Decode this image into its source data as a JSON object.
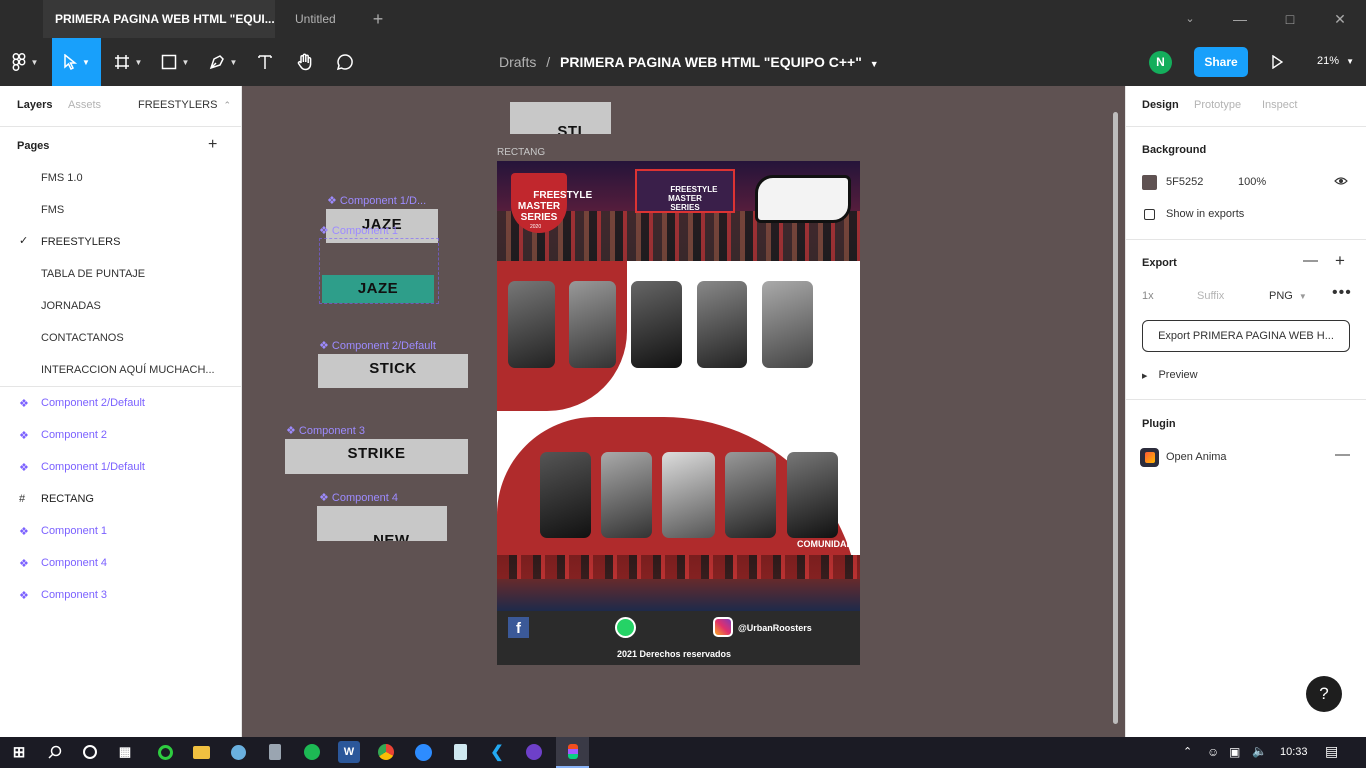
{
  "tabs": [
    {
      "label": "PRIMERA PAGINA WEB HTML \"EQUI..."
    },
    {
      "label": "Untitled"
    }
  ],
  "toolbar": {
    "breadcrumb_parent": "Drafts",
    "breadcrumb_sep": "/",
    "file_title": "PRIMERA PAGINA WEB HTML \"EQUIPO C++\"",
    "avatar_initial": "N",
    "share_label": "Share",
    "zoom": "21%"
  },
  "left_panel": {
    "tab_layers": "Layers",
    "tab_assets": "Assets",
    "current_page": "FREESTYLERS",
    "pages_heading": "Pages",
    "pages": [
      "FMS 1.0",
      "FMS",
      "FREESTYLERS",
      "TABLA DE PUNTAJE",
      "JORNADAS",
      "CONTACTANOS",
      "INTERACCION AQUÍ MUCHACH..."
    ],
    "layers": [
      {
        "label": "Component 2/Default",
        "icon": "component-icon"
      },
      {
        "label": "Component 2",
        "icon": "component-icon"
      },
      {
        "label": "Component 1/Default",
        "icon": "component-icon"
      },
      {
        "label": "RECTANG",
        "icon": "frame-icon"
      },
      {
        "label": "Component 1",
        "icon": "component-icon"
      },
      {
        "label": "Component 4",
        "icon": "component-icon"
      },
      {
        "label": "Component 3",
        "icon": "component-icon"
      }
    ]
  },
  "canvas": {
    "background": "#5F5252",
    "top_frame_text": "STI\nCK",
    "frame_label": "RECTANG",
    "components": {
      "c1_default_label": "Component 1/D...",
      "c1_default_text": "JAZE",
      "c1_label": "Component 1",
      "c1_text": "JAZE",
      "c2_label": "Component 2/Default",
      "c2_text": "STICK",
      "c3_label": "Component 3",
      "c3_text": "STRIKE",
      "c4_label": "Component 4",
      "c4_text": "NEW\nERA"
    },
    "design": {
      "banner_logo": "FREESTYLE\nMASTER\nSERIES",
      "banner_year": "2020",
      "banner_logo2": "FREESTYLE\nMASTER\nSERIES",
      "comunidad": "COMUNIDAD",
      "instagram_handle": "@UrbanRoosters",
      "footer": "2021 Derechos reservados"
    }
  },
  "right_panel": {
    "tab_design": "Design",
    "tab_prototype": "Prototype",
    "tab_inspect": "Inspect",
    "background_heading": "Background",
    "bg_hex": "5F5252",
    "bg_opacity": "100%",
    "show_in_exports": "Show in exports",
    "export_heading": "Export",
    "export_scale": "1x",
    "export_suffix_placeholder": "Suffix",
    "export_format": "PNG",
    "export_button": "Export PRIMERA PAGINA WEB H...",
    "preview_label": "Preview",
    "plugin_heading": "Plugin",
    "plugin_name": "Open Anima",
    "help": "?"
  },
  "taskbar": {
    "clock": "10:33"
  },
  "colors": {
    "accent": "#7B61FF",
    "share_blue": "#18A0FB",
    "avatar_green": "#14AE5C",
    "canvas_bg": "#5F5252",
    "design_red": "#B02B2C",
    "teal": "#2E9E8A"
  }
}
